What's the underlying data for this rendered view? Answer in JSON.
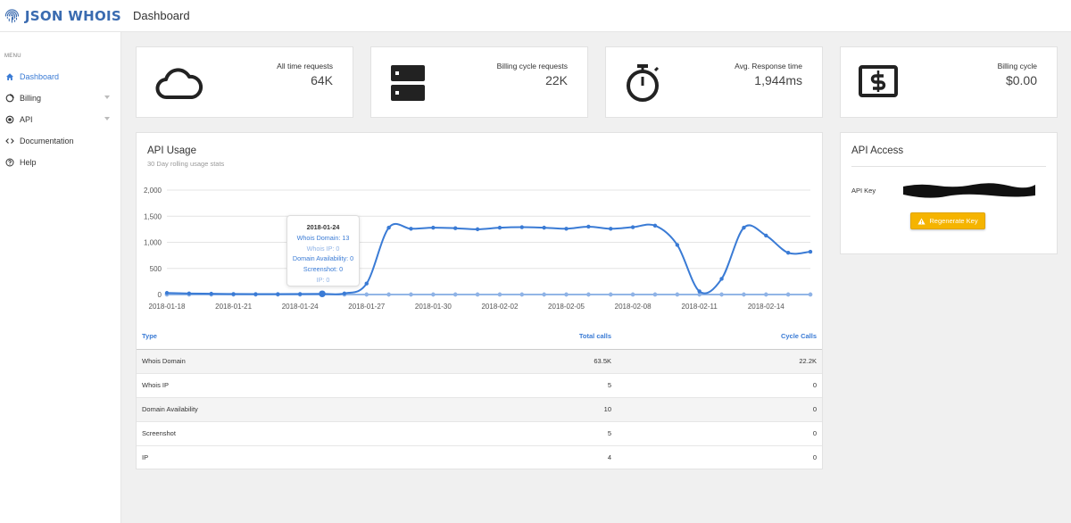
{
  "header": {
    "brand": "JSON WHOIS",
    "title": "Dashboard"
  },
  "sidebar": {
    "heading": "MENU",
    "items": [
      {
        "label": "Dashboard",
        "icon": "home-icon",
        "active": true
      },
      {
        "label": "Billing",
        "icon": "circle-outline-icon",
        "has_submenu": true
      },
      {
        "label": "API",
        "icon": "radio-icon",
        "has_submenu": true
      },
      {
        "label": "Documentation",
        "icon": "code-icon"
      },
      {
        "label": "Help",
        "icon": "help-circle-icon"
      }
    ]
  },
  "stats": [
    {
      "label": "All time requests",
      "value": "64K",
      "icon": "cloud-icon"
    },
    {
      "label": "Billing cycle requests",
      "value": "22K",
      "icon": "server-icon"
    },
    {
      "label": "Avg. Response time",
      "value": "1,944ms",
      "icon": "stopwatch-icon"
    },
    {
      "label": "Billing cycle",
      "value": "$0.00",
      "icon": "dollar-icon"
    }
  ],
  "usage": {
    "title": "API Usage",
    "subtitle": "30 Day rolling usage stats",
    "tooltip": {
      "date": "2018-01-24",
      "lines": [
        "Whois Domain: 13",
        "Whois IP: 0",
        "Domain Availability: 0",
        "Screenshot: 0",
        "IP: 0"
      ]
    },
    "table": {
      "headers": [
        "Type",
        "Total calls",
        "Cycle Calls"
      ],
      "rows": [
        [
          "Whois Domain",
          "63.5K",
          "22.2K"
        ],
        [
          "Whois IP",
          "5",
          "0"
        ],
        [
          "Domain Availability",
          "10",
          "0"
        ],
        [
          "Screenshot",
          "5",
          "0"
        ],
        [
          "IP",
          "4",
          "0"
        ]
      ]
    }
  },
  "chart_data": {
    "type": "line",
    "title": "",
    "ylim": [
      0,
      2000
    ],
    "yticks": [
      "2,000",
      "1,500",
      "1,000",
      "500",
      "0"
    ],
    "xtick_labels": [
      "2018-01-18",
      "2018-01-21",
      "2018-01-24",
      "2018-01-27",
      "2018-01-30",
      "2018-02-02",
      "2018-02-05",
      "2018-02-08",
      "2018-02-11",
      "2018-02-14"
    ],
    "x": [
      "2018-01-18",
      "2018-01-19",
      "2018-01-20",
      "2018-01-21",
      "2018-01-22",
      "2018-01-23",
      "2018-01-24",
      "2018-01-25",
      "2018-01-26",
      "2018-01-27",
      "2018-01-28",
      "2018-01-29",
      "2018-01-30",
      "2018-01-31",
      "2018-02-01",
      "2018-02-02",
      "2018-02-03",
      "2018-02-04",
      "2018-02-05",
      "2018-02-06",
      "2018-02-07",
      "2018-02-08",
      "2018-02-09",
      "2018-02-10",
      "2018-02-11",
      "2018-02-12",
      "2018-02-13",
      "2018-02-14",
      "2018-02-15"
    ],
    "highlight_index": 7,
    "series": [
      {
        "name": "Whois Domain",
        "color": "#3a7bd5",
        "values": [
          30,
          20,
          15,
          10,
          8,
          8,
          10,
          13,
          20,
          210,
          1280,
          1260,
          1280,
          1270,
          1250,
          1280,
          1290,
          1280,
          1260,
          1300,
          1260,
          1290,
          1320,
          950,
          60,
          300,
          1280,
          1130,
          800,
          820
        ]
      },
      {
        "name": "Whois IP",
        "color": "#8fb3e6",
        "values": [
          0,
          0,
          0,
          0,
          0,
          0,
          0,
          0,
          0,
          0,
          0,
          0,
          0,
          0,
          0,
          0,
          0,
          0,
          0,
          0,
          0,
          0,
          0,
          0,
          0,
          0,
          0,
          0,
          0,
          0
        ]
      },
      {
        "name": "Domain Availability",
        "color": "#8fb3e6",
        "values": [
          0,
          0,
          0,
          0,
          0,
          0,
          0,
          0,
          0,
          0,
          0,
          0,
          0,
          0,
          0,
          0,
          0,
          0,
          0,
          0,
          0,
          0,
          0,
          0,
          0,
          0,
          0,
          0,
          0,
          0
        ]
      },
      {
        "name": "Screenshot",
        "color": "#8fb3e6",
        "values": [
          0,
          0,
          0,
          0,
          0,
          0,
          0,
          0,
          0,
          0,
          0,
          0,
          0,
          0,
          0,
          0,
          0,
          0,
          0,
          0,
          0,
          0,
          0,
          0,
          0,
          0,
          0,
          0,
          0,
          0
        ]
      },
      {
        "name": "IP",
        "color": "#8fb3e6",
        "values": [
          0,
          0,
          0,
          0,
          0,
          0,
          0,
          0,
          0,
          0,
          0,
          0,
          0,
          0,
          0,
          0,
          0,
          0,
          0,
          0,
          0,
          0,
          0,
          0,
          0,
          0,
          0,
          0,
          0,
          0
        ]
      }
    ]
  },
  "access": {
    "title": "API Access",
    "key_label": "API Key",
    "regenerate_label": "Regenerate Key"
  }
}
